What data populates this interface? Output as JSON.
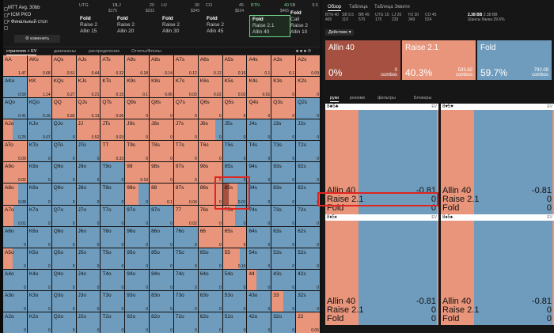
{
  "topbar": {
    "tournament": "MTT",
    "avg": "Avg. 30bb",
    "format": "ICM PKO",
    "stage": "Финальный стол",
    "change_label": "изменить"
  },
  "positions": [
    {
      "name": "UTG",
      "bb": "15",
      "stack": "$175",
      "first": "Fold",
      "lines": [
        "Raise 2",
        "Allin 15"
      ]
    },
    {
      "name": "LJ",
      "bb": "20",
      "stack": "$233",
      "first": "Fold",
      "lines": [
        "Raise 2",
        "Allin 20"
      ]
    },
    {
      "name": "HJ",
      "bb": "30",
      "stack": "$349",
      "first": "Fold",
      "lines": [
        "Raise 2",
        "Allin 30"
      ]
    },
    {
      "name": "CO",
      "bb": "45",
      "stack": "$524",
      "first": "Fold",
      "lines": [
        "Raise 2",
        "Allin 45"
      ]
    },
    {
      "name": "BTN",
      "bb": "40",
      "stack": "$465",
      "first": "Fold",
      "lines": [
        "Raise 2.1",
        "Allin 40"
      ]
    },
    {
      "name": "SB",
      "bb": "9.5",
      "stack": "",
      "first": "Fold",
      "lines": [
        "Call",
        "Raise 2",
        "Allin 10"
      ]
    }
  ],
  "grid_tabs": [
    "стратегия + EV",
    "диапазоны",
    "распределение",
    "Отчеты/Флопы"
  ],
  "right": {
    "tabs": [
      "Обзор",
      "Таблица",
      "Таблица Эквити"
    ],
    "stats": [
      {
        "l": "BTN 40",
        "v": "465"
      },
      {
        "l": "SB 9.5",
        "v": "110"
      },
      {
        "l": "BB 49",
        "v": "570"
      },
      {
        "l": "UTG 15",
        "v": "175"
      },
      {
        "l": "LJ 20",
        "v": "233"
      },
      {
        "l": "HJ 30",
        "v": "349"
      },
      {
        "l": "CO 45",
        "v": "524"
      }
    ],
    "pot": "2.38 BB",
    "pot2": "2.38 BB",
    "bounty": "Шансы банка",
    "bounty_v": "29.6%",
    "actions_label": "Действие",
    "actions": [
      {
        "name": "Allin 40",
        "pct": "0%",
        "combos": "0",
        "cl": "combos"
      },
      {
        "name": "Raise 2.1",
        "pct": "40.3%",
        "combos": "533.82",
        "cl": "combos"
      },
      {
        "name": "Fold",
        "pct": "59.7%",
        "combos": "792.08",
        "cl": "combos"
      }
    ],
    "subtabs": [
      "руки",
      "резюме",
      "фильтры",
      "Блокеры"
    ],
    "combos": [
      {
        "hand": "8♣5♣",
        "ev": "EV",
        "rows": [
          [
            "Allin 40",
            "-0.81"
          ],
          [
            "Raise 2.1",
            "0"
          ],
          [
            "Fold",
            "0"
          ]
        ]
      },
      {
        "hand": "8♥5♥",
        "ev": "EV",
        "rows": [
          [
            "Allin 40",
            "-0.81"
          ],
          [
            "Raise 2.1",
            "0"
          ],
          [
            "Fold",
            "0"
          ]
        ]
      },
      {
        "hand": "8♦5♦",
        "ev": "EV",
        "rows": [
          [
            "Allin 40",
            "-0.81"
          ],
          [
            "Raise 2.1",
            "0"
          ],
          [
            "Fold",
            "0"
          ]
        ]
      },
      {
        "hand": "8♠5♠",
        "ev": "EV",
        "rows": [
          [
            "Allin 40",
            "-0.81"
          ],
          [
            "Raise 2.1",
            "0"
          ],
          [
            "Fold",
            "0"
          ]
        ]
      }
    ]
  },
  "grid": [
    [
      "AA|1.47|0|",
      "AKs|0.68|0|",
      "AQs|0.51|0|",
      "AJs|0.44|0|",
      "ATs|0.32|0|",
      "A9s|0.18|0|",
      "A8s|0.14|0|",
      "A7s|0.12|0|",
      "A6s|0.12|0|",
      "A5s|0.16|0|",
      "A4s|0.1|0|",
      "A3s|0.1|0|",
      "A2s|0.09|0|"
    ],
    [
      "AKo|0.59|1|",
      "KK|1.14|0|",
      "KQs|0.27|0|",
      "KJs|0.21|0|",
      "KTs|0.15|0|",
      "K9s|0.1|0|",
      "K8s|0.06|0|",
      "K7s|0.03|0|",
      "K6s|0.02|0|",
      "K5s|0.02|0|",
      "K4s|0.01|0|",
      "K3s|0|0|",
      "K2s|0|0|"
    ],
    [
      "AQo|0.41|1|",
      "KQo|0.16|1|",
      "QQ|0.83|0|",
      "QJs|0.13|0|",
      "QTs|0.06|0|",
      "Q9s|0|0|",
      "Q8s|0|0|",
      "Q7s|0|0|",
      "Q6s|0|0|",
      "Q5s|0|0|",
      "Q4s|0|0|",
      "Q3s|0|0|",
      "Q2s|0|1|"
    ],
    [
      "AJo|0.25|0.6|",
      "KJo|0.07|1|",
      "QJo|0|1|",
      "JJ|0.52|0|",
      "JTs|0.03|0|",
      "J9s|0|0|",
      "J8s|0|0|",
      "J7s|0|0|",
      "J6s|0|0.3|",
      "J5s|0|1|",
      "J4s|0|1|",
      "J3s|0|1|",
      "J2s|0|1|"
    ],
    [
      "ATo|0.09|0|",
      "KTo|0|1|",
      "QTo|0|1|",
      "JTo|0|1|",
      "TT|0.33|0|",
      "T9s|0|0|",
      "T8s|0|0|",
      "T7s|0|0|",
      "T6s|0|0|",
      "T5s|0|1|",
      "T4s|0|1|",
      "T3s|0|1|",
      "T2s|0|1|"
    ],
    [
      "A9o|0.02|0|",
      "K9o|0|1|",
      "Q9o|0|1|",
      "J9o|0|1|",
      "T9o|0|1|",
      "99|0.19|0|",
      "98s|0|0|",
      "97s|0|0|",
      "96s|0|0|",
      "95s|0|1|",
      "94s|0|1|",
      "93s|0|1|",
      "92s|0|1|"
    ],
    [
      "A8o|0.08|0.35|",
      "K8o|0|1|",
      "Q8o|0|1|",
      "J8o|0|1|",
      "T8o|0|1|",
      "98o|0|0.45|",
      "88|0.1|0|",
      "87s|0.04|0|",
      "86s|0|0|",
      "85s|0.01|0.4|",
      "84s|0|1|",
      "83s|0|1|",
      "82s|0|1|"
    ],
    [
      "A7o|0.01|0.55|",
      "K7o|0|1|",
      "Q7o|0|1|",
      "J7o|0|1|",
      "T7o|0|1|",
      "97o|0|1|",
      "87o|0|1|",
      "77|0.02|0|",
      "76s|0|0|",
      "75s|0|0.5|",
      "74s|0|1|",
      "73s|0|1|",
      "72s|0|1|"
    ],
    [
      "A6o|0|1|",
      "K6o|0|1|",
      "Q6o|0|1|",
      "J6o|0|1|",
      "T6o|0|1|",
      "96o|0|1|",
      "86o|0|1|",
      "76o|0|1|",
      "66|0|0|",
      "65s|0|0|",
      "64s|0|1|",
      "63s|0|1|",
      "62s|0|1|"
    ],
    [
      "A5o|0|0.6|",
      "K5o|0|1|",
      "Q5o|0|1|",
      "J5o|0|1|",
      "T5o|0|1|",
      "95o|0|1|",
      "85o|0|1|",
      "75o|0|1|",
      "65o|0|1|",
      "55|0.16|0.3|",
      "54s|0|1|",
      "53s|0|1|",
      "52s|0|1|"
    ],
    [
      "A4o|0|1|",
      "K4o|0|1|",
      "Q4o|0|1|",
      "J4o|0|1|",
      "T4o|0|1|",
      "94o|0|1|",
      "84o|0|1|",
      "74o|0|1|",
      "64o|0|1|",
      "54o|0|1|",
      "44|0|0.6|",
      "43s|0|1|",
      "42s|0|1|"
    ],
    [
      "A3o|0|1|",
      "K3o|0|1|",
      "Q3o|0|1|",
      "J3o|0|1|",
      "T3o|0|1|",
      "93o|0|1|",
      "83o|0|1|",
      "73o|0|1|",
      "63o|0|1|",
      "53o|0|1|",
      "43o|0|1|",
      "33|0|0.5|",
      "32s|0|1|"
    ],
    [
      "A2o|0|1|",
      "K2o|0|1|",
      "Q2o|0|1|",
      "J2o|0|1|",
      "T2o|0|1|",
      "92o|0|1|",
      "82o|0|1|",
      "72o|0|1|",
      "62o|0|1|",
      "52o|0|1|",
      "42o|0|1|",
      "32o|0|1|",
      "22|0.05|0|"
    ]
  ],
  "colors": {
    "raise": "#e8957b",
    "fold": "#6f9cbd",
    "allin": "#a55040",
    "highlight": "#e0241f"
  }
}
